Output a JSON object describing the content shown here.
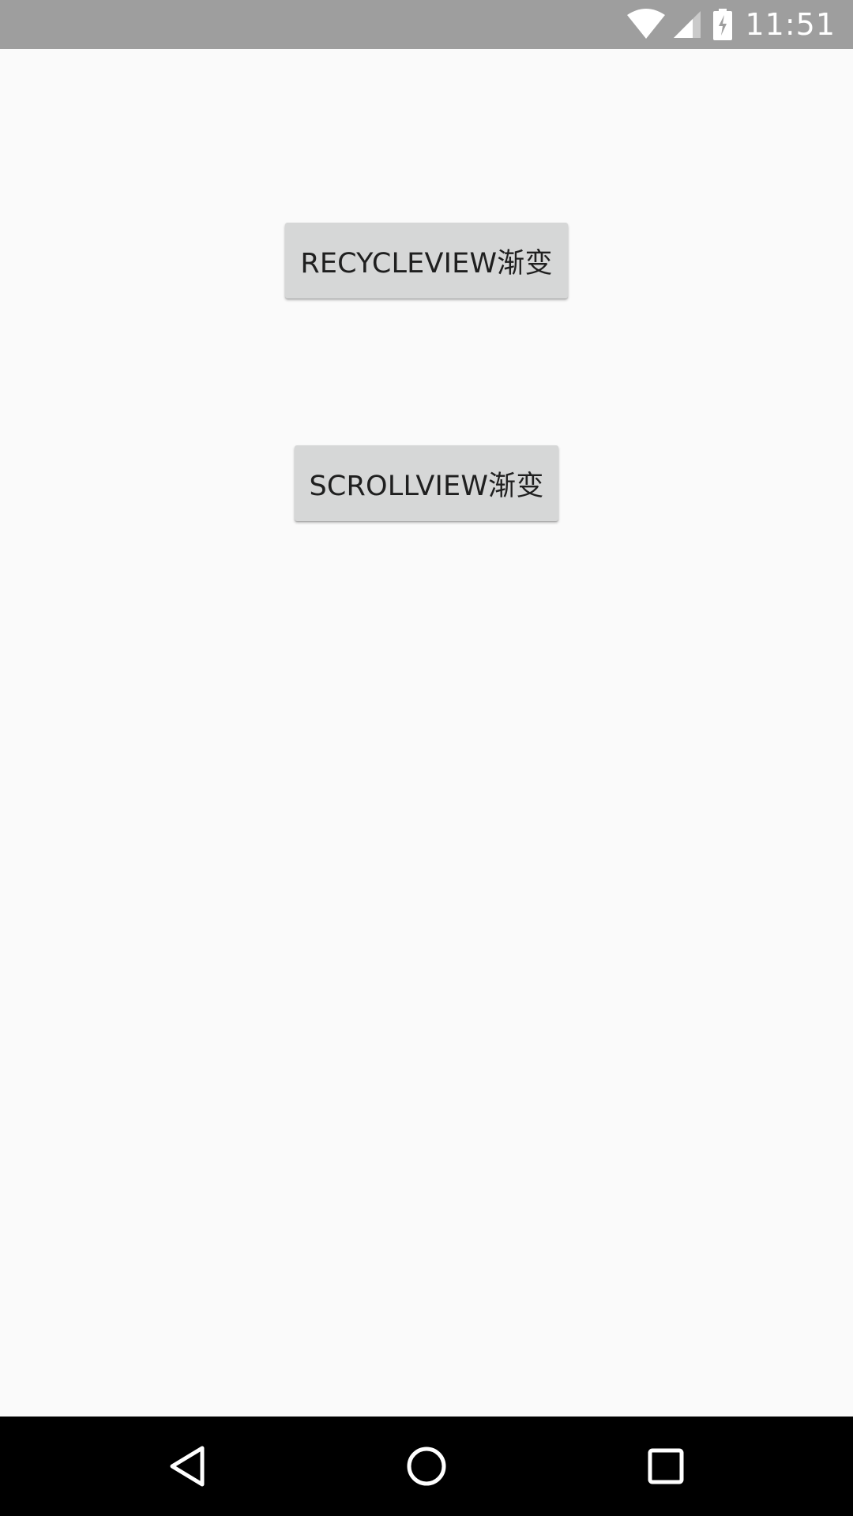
{
  "status_bar": {
    "time": "11:51",
    "icons": [
      "wifi-icon",
      "signal-icon",
      "battery-charging-icon"
    ]
  },
  "main": {
    "buttons": [
      {
        "label": "RECYCLEVIEW渐变"
      },
      {
        "label": "SCROLLVIEW渐变"
      }
    ]
  },
  "nav_bar": {
    "icons": [
      "back-icon",
      "home-icon",
      "recents-icon"
    ]
  },
  "colors": {
    "status_bar": "#9e9e9e",
    "background": "#fafafa",
    "button": "#d6d7d7",
    "nav_bar": "#000000"
  }
}
